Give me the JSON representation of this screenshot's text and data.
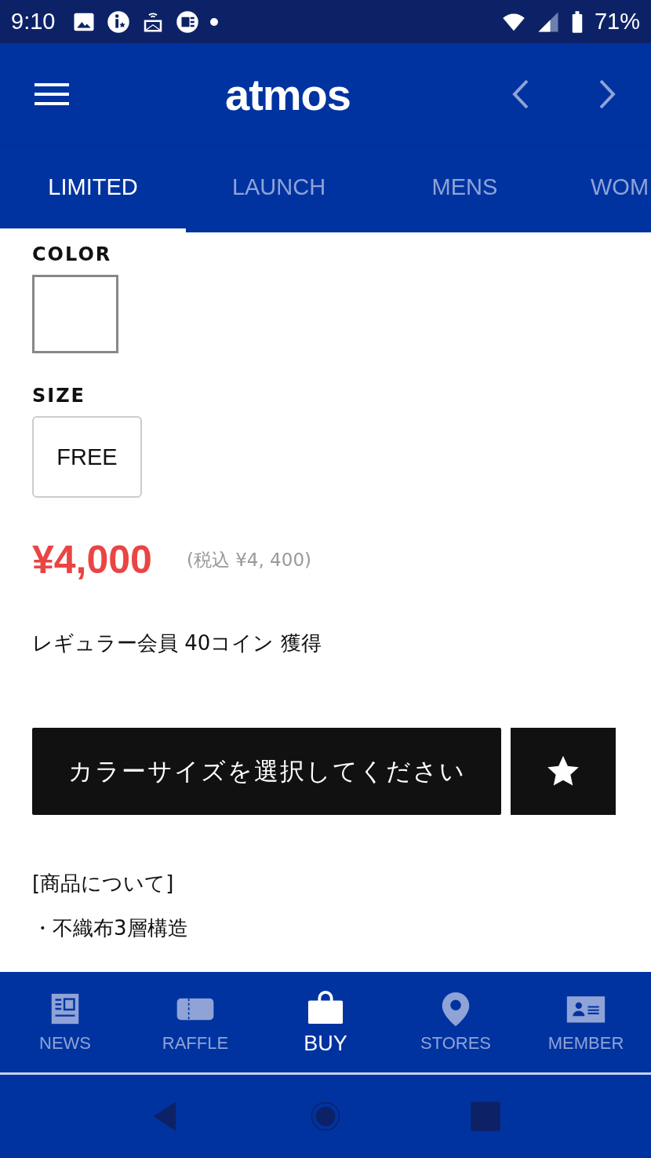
{
  "status_bar": {
    "time": "9:10",
    "battery": "71%"
  },
  "header": {
    "logo": "atmos"
  },
  "tabs": [
    {
      "label": "LIMITED",
      "selected": true
    },
    {
      "label": "LAUNCH",
      "selected": false
    },
    {
      "label": "MENS",
      "selected": false
    },
    {
      "label": "WOM",
      "selected": false
    }
  ],
  "color_section": {
    "label": "COLOR"
  },
  "size_section": {
    "label": "SIZE",
    "options": [
      "FREE"
    ]
  },
  "price": "¥4,000",
  "tax_price": "(税込 ¥4, 400)",
  "points": "レギュラー会員 40コイン 獲得",
  "select_button": "カラーサイズを選択してください",
  "description": {
    "heading": "[商品について]",
    "lines": [
      "・不織布3層構造"
    ]
  },
  "bottom_nav": [
    {
      "label": "NEWS",
      "kind": "news",
      "selected": false
    },
    {
      "label": "RAFFLE",
      "kind": "ticket",
      "selected": false
    },
    {
      "label": "BUY",
      "kind": "bag",
      "selected": true
    },
    {
      "label": "STORES",
      "kind": "pin",
      "selected": false
    },
    {
      "label": "MEMBER",
      "kind": "card",
      "selected": false
    }
  ]
}
